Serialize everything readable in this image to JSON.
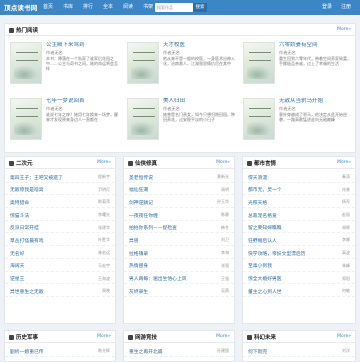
{
  "header": {
    "logo": "顶点读书网",
    "nav": [
      "首页",
      "书库",
      "排行",
      "全本",
      "阅读",
      "书架"
    ],
    "search_placeholder": "搜索作品",
    "search_button": "搜索",
    "login": "登录",
    "register": "注册"
  },
  "hot": {
    "title": "热门阅读",
    "more": "More»",
    "books": [
      {
        "title": "公主殿下来驾到",
        "author": "作者无名",
        "desc": "本书：降落在一个私家了谁家后花园之中……公主与奇书之间，她的命运将会怎样"
      },
      {
        "title": "天才校医",
        "author": "作者无名",
        "desc": "他从来不是一般的校医，一身医术出神入化，治病救人，江湖恩怨情仇尽在其中"
      },
      {
        "title": "六零娇妻有空间",
        "author": "作者无名",
        "desc": "重生回到六零年代，带着空间养家致富，手撕极品亲戚，过上了幸福的生活"
      },
      {
        "title": "七年一梦说回首",
        "author": "作者无名",
        "desc": "谁说七年之痒？她用七年换来一场梦，醒来才发现原来身边人一直都在"
      },
      {
        "title": "美人归田",
        "author": "作者无名",
        "desc": "她曾是名门贵女，如今只想归隐田园，种田养花，过安稳平淡的小日子"
      },
      {
        "title": "无敌从当驸马开始",
        "author": "作者无名",
        "desc": "意外穿越成了驸马，他决定从此开始逆袭，一路高歌猛进走向无敌巅峰"
      }
    ]
  },
  "sections": [
    {
      "title": "二次元",
      "more": "More»",
      "rows": [
        {
          "name": "第四王子：王吧又被遗了",
          "author": "程新宇"
        },
        {
          "name": "无敌惊我是啥窝",
          "author": "尹明灯"
        },
        {
          "name": "奥特猎命",
          "author": "陈菊萍"
        },
        {
          "name": "惊猫斗法",
          "author": "李曙光"
        },
        {
          "name": "反派日常开挂",
          "author": "张建华"
        },
        {
          "name": "草丛打怪最有戏",
          "author": "叶胜华"
        },
        {
          "name": "无名好",
          "author": "林宏远"
        },
        {
          "name": "海阔天",
          "author": "马宏宇"
        },
        {
          "name": "逆星王",
          "author": "王海波"
        },
        {
          "name": "异世重生之无敌",
          "author": "周晓"
        }
      ]
    },
    {
      "title": "仙侠修真",
      "more": "More»",
      "rows": [
        {
          "name": "圣老恒传说",
          "author": "黄新光"
        },
        {
          "name": "福仙狂潮",
          "author": "周明"
        },
        {
          "name": "剑神逆鳞记",
          "author": "孙玉华"
        },
        {
          "name": "一夜夜任你缠",
          "author": "陈静"
        },
        {
          "name": "拍拍你系列ーー捉检查",
          "author": "韩冬"
        },
        {
          "name": "异兽",
          "author": "刘卫"
        },
        {
          "name": "拉格镇录",
          "author": "李海"
        },
        {
          "name": "热情替身",
          "author": "张强"
        },
        {
          "name": "男人再每：遍出生悟心上风",
          "author": "王强"
        },
        {
          "name": "灰烬录生",
          "author": "吴燕"
        }
      ]
    },
    {
      "title": "都市言情",
      "more": "More»",
      "rows": [
        {
          "name": "悍天浪漫",
          "author": "秦涛"
        },
        {
          "name": "都市无，灵一个",
          "author": "徐勇"
        },
        {
          "name": "光照天格",
          "author": "杨军"
        },
        {
          "name": "总裁宠名格爱",
          "author": "赵丽"
        },
        {
          "name": "留之要知嫁瞧瞧",
          "author": "周辉"
        },
        {
          "name": "狂野婚后认人",
          "author": "李娜"
        },
        {
          "name": "快学攻略，帝妖文型漂后历",
          "author": "高波"
        },
        {
          "name": "至毒小到我",
          "author": "林峰"
        },
        {
          "name": "惊全大婚好男医",
          "author": "郑阳"
        },
        {
          "name": "董主之心到人世",
          "author": "何敏"
        }
      ]
    },
    {
      "title": "历史军事",
      "more": "More»",
      "rows": [
        {
          "name": "剧析一娘重已传",
          "author": "陈光辉"
        }
      ]
    },
    {
      "title": "网游竞技",
      "more": "More»",
      "rows": [
        {
          "name": "重生之再开北扁",
          "author": "孙建国"
        }
      ]
    },
    {
      "title": "科幻未来",
      "more": "More»",
      "rows": [
        {
          "name": "何下就完",
          "author": "刘洋"
        }
      ]
    }
  ]
}
